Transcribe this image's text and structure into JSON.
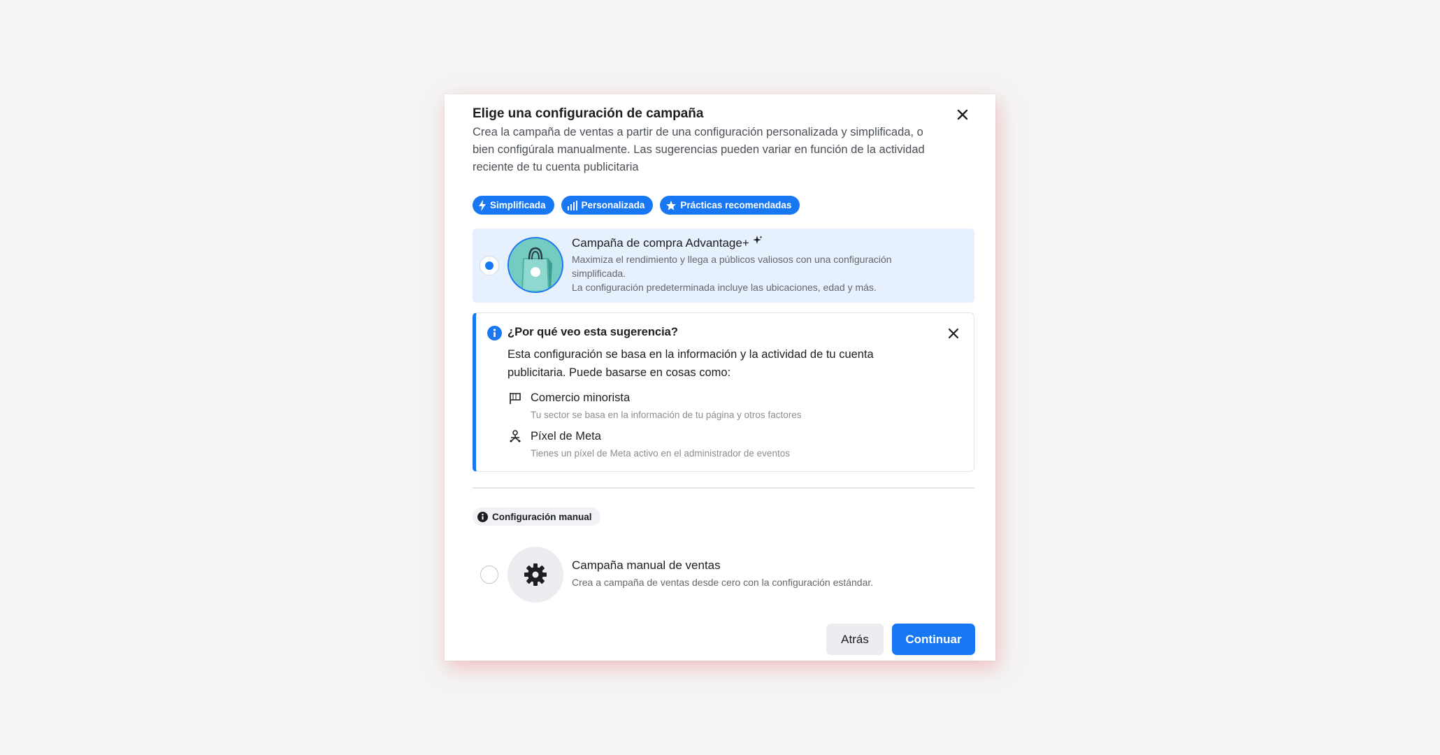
{
  "dialog": {
    "title": "Elige una configuración de campaña",
    "subtitle": "Crea la campaña de ventas a partir de una configuración personalizada y simplificada, o bien configúrala manualmente. Las sugerencias pueden variar en función de la actividad reciente de tu cuenta publicitaria",
    "close_icon": "close-icon"
  },
  "tags": [
    {
      "label": "Simplificada",
      "icon": "lightning-icon"
    },
    {
      "label": "Personalizada",
      "icon": "bars-icon"
    },
    {
      "label": "Prácticas recomendadas",
      "icon": "star-icon"
    }
  ],
  "advantage_option": {
    "title": "Campaña de compra Advantage+",
    "description_1": "Maximiza el rendimiento y llega a públicos valiosos con una configuración simplificada.",
    "description_2": "La configuración predeterminada incluye las ubicaciones, edad y más.",
    "selected": true
  },
  "why": {
    "title": "¿Por qué veo esta sugerencia?",
    "body": "Esta configuración se basa en la información y la actividad de tu cuenta publicitaria. Puede basarse en cosas como:",
    "items": [
      {
        "title": "Comercio minorista",
        "desc": "Tu sector se basa en la información de tu página y otros factores",
        "icon": "flag-icon"
      },
      {
        "title": "Píxel de Meta",
        "desc": "Tienes un píxel de Meta activo en el administrador de eventos",
        "icon": "pixel-icon"
      }
    ]
  },
  "manual": {
    "badge": "Configuración manual",
    "title": "Campaña manual de ventas",
    "description": "Crea a campaña de ventas desde cero con la configuración estándar.",
    "selected": false
  },
  "buttons": {
    "back": "Atrás",
    "continue": "Continuar"
  },
  "colors": {
    "accent": "#1877f2",
    "selected_bg": "#e7f0fd",
    "page_bg": "#f4f4f4"
  }
}
